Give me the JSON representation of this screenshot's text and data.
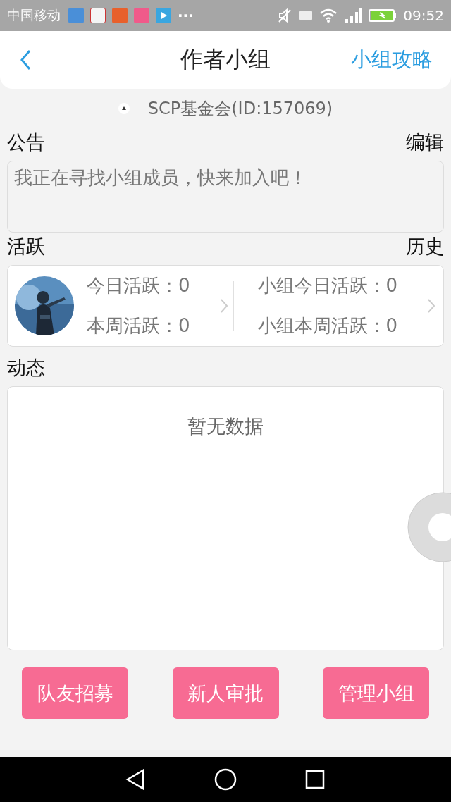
{
  "status_bar": {
    "carrier": "中国移动",
    "more": "···",
    "time": "09:52"
  },
  "header": {
    "title": "作者小组",
    "link": "小组攻略"
  },
  "group_name": "SCP基金会(ID:157069)",
  "announcement": {
    "label": "公告",
    "action": "编辑",
    "text": "我正在寻找小组成员，快来加入吧！"
  },
  "activity": {
    "label": "活跃",
    "action": "历史",
    "personal": [
      {
        "label": "今日活跃：",
        "value": "0"
      },
      {
        "label": "本周活跃：",
        "value": "0"
      }
    ],
    "group": [
      {
        "label": "小组今日活跃：",
        "value": "0"
      },
      {
        "label": "小组本周活跃：",
        "value": "0"
      }
    ]
  },
  "feed": {
    "label": "动态",
    "empty": "暂无数据"
  },
  "buttons": [
    "队友招募",
    "新人审批",
    "管理小组"
  ]
}
